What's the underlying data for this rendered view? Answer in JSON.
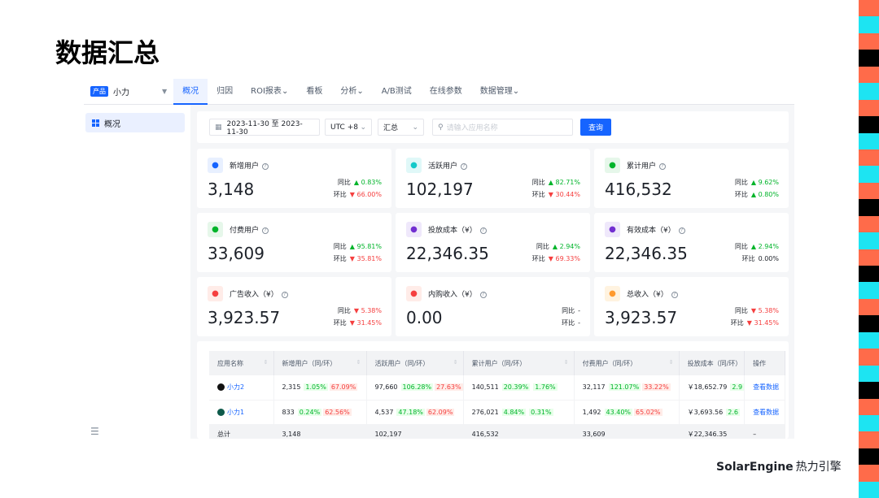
{
  "slide_title": "数据汇总",
  "nav": {
    "product_tag": "产品",
    "product_name": "小力",
    "items": [
      "概况",
      "归因",
      "ROI报表",
      "看板",
      "分析",
      "A/B测试",
      "在线参数",
      "数据管理"
    ]
  },
  "sidebar": {
    "item": "概况"
  },
  "filters": {
    "date_range": "2023-11-30 至 2023-11-30",
    "timezone": "UTC +8",
    "mode": "汇总",
    "search_placeholder": "请输入应用名称",
    "query_label": "查询"
  },
  "compare_labels": {
    "yoy": "同比",
    "mom": "环比"
  },
  "cards": [
    {
      "title": "新增用户",
      "value": "3,148",
      "yoy": "0.83%",
      "yoy_dir": "up",
      "mom": "66.00%",
      "mom_dir": "down",
      "color": "#1664ff",
      "bg": "#e8f0ff",
      "icon": "user-add-icon"
    },
    {
      "title": "活跃用户",
      "value": "102,197",
      "yoy": "82.71%",
      "yoy_dir": "up",
      "mom": "30.44%",
      "mom_dir": "down",
      "color": "#14c9c9",
      "bg": "#e0f8f8",
      "icon": "active-user-icon"
    },
    {
      "title": "累计用户",
      "value": "416,532",
      "yoy": "9.62%",
      "yoy_dir": "up",
      "mom": "0.80%",
      "mom_dir": "up",
      "color": "#00b42a",
      "bg": "#e6f7ea",
      "icon": "users-icon"
    },
    {
      "title": "付费用户",
      "value": "33,609",
      "yoy": "95.81%",
      "yoy_dir": "up",
      "mom": "35.81%",
      "mom_dir": "down",
      "color": "#00b42a",
      "bg": "#e6f7ea",
      "icon": "paying-user-icon"
    },
    {
      "title": "投放成本（¥）",
      "value": "22,346.35",
      "yoy": "2.94%",
      "yoy_dir": "up",
      "mom": "69.33%",
      "mom_dir": "down",
      "color": "#722ed1",
      "bg": "#efe8fb",
      "icon": "cost-icon"
    },
    {
      "title": "有效成本（¥）",
      "value": "22,346.35",
      "yoy": "2.94%",
      "yoy_dir": "up",
      "mom": "0.00%",
      "mom_dir": "none",
      "color": "#722ed1",
      "bg": "#efe8fb",
      "icon": "effective-cost-icon"
    },
    {
      "title": "广告收入（¥）",
      "value": "3,923.57",
      "yoy": "5.38%",
      "yoy_dir": "down",
      "mom": "31.45%",
      "mom_dir": "down",
      "color": "#f53f3f",
      "bg": "#ffece8",
      "icon": "ad-icon"
    },
    {
      "title": "内购收入（¥）",
      "value": "0.00",
      "yoy": "-",
      "yoy_dir": "none",
      "mom": "-",
      "mom_dir": "none",
      "color": "#f53f3f",
      "bg": "#ffece8",
      "icon": "purchase-icon"
    },
    {
      "title": "总收入（¥）",
      "value": "3,923.57",
      "yoy": "5.38%",
      "yoy_dir": "down",
      "mom": "31.45%",
      "mom_dir": "down",
      "color": "#ff9a2e",
      "bg": "#fff3e0",
      "icon": "revenue-icon"
    }
  ],
  "table": {
    "headers": [
      "应用名称",
      "新增用户（同/环）",
      "活跃用户（同/环）",
      "累计用户（同/环）",
      "付费用户（同/环）",
      "投放成本（同/环）",
      "操作"
    ],
    "rows": [
      {
        "app": "小力2",
        "dot": "#111111",
        "c1": "2,315",
        "c1a": "1.05%",
        "c1b": "67.09%",
        "c2": "97,660",
        "c2a": "106.28%",
        "c2b": "27.63%",
        "c3": "140,511",
        "c3a": "20.39%",
        "c3b": "1.76%",
        "c4": "32,117",
        "c4a": "121.07%",
        "c4b": "33.22%",
        "c5": "￥18,652.79",
        "c5a": "2.9",
        "action": "查看数据"
      },
      {
        "app": "小力1",
        "dot": "#0e5a4a",
        "c1": "833",
        "c1a": "0.24%",
        "c1b": "62.56%",
        "c2": "4,537",
        "c2a": "47.18%",
        "c2b": "62.09%",
        "c3": "276,021",
        "c3a": "4.84%",
        "c3b": "0.31%",
        "c4": "1,492",
        "c4a": "43.40%",
        "c4b": "65.02%",
        "c5": "￥3,693.56",
        "c5a": "2.6",
        "action": "查看数据"
      }
    ],
    "total": {
      "label": "总计",
      "c1": "3,148",
      "c2": "102,197",
      "c3": "416,532",
      "c4": "33,609",
      "c5": "￥22,346.35",
      "action": "–"
    }
  },
  "logo": {
    "en": "SolarEngine",
    "cn": "热力引擎"
  },
  "deco_colors": [
    "#ff6b4a",
    "#1de4f2",
    "#ff6b4a",
    "#000",
    "#ff6b4a",
    "#1de4f2",
    "#ff6b4a",
    "#000",
    "#1de4f2",
    "#ff6b4a",
    "#1de4f2",
    "#ff6b4a",
    "#000",
    "#ff6b4a",
    "#1de4f2",
    "#ff6b4a",
    "#000",
    "#1de4f2",
    "#ff6b4a",
    "#000",
    "#1de4f2",
    "#ff6b4a",
    "#1de4f2",
    "#000",
    "#ff6b4a",
    "#1de4f2",
    "#ff6b4a",
    "#000",
    "#ff6b4a",
    "#1de4f2"
  ]
}
